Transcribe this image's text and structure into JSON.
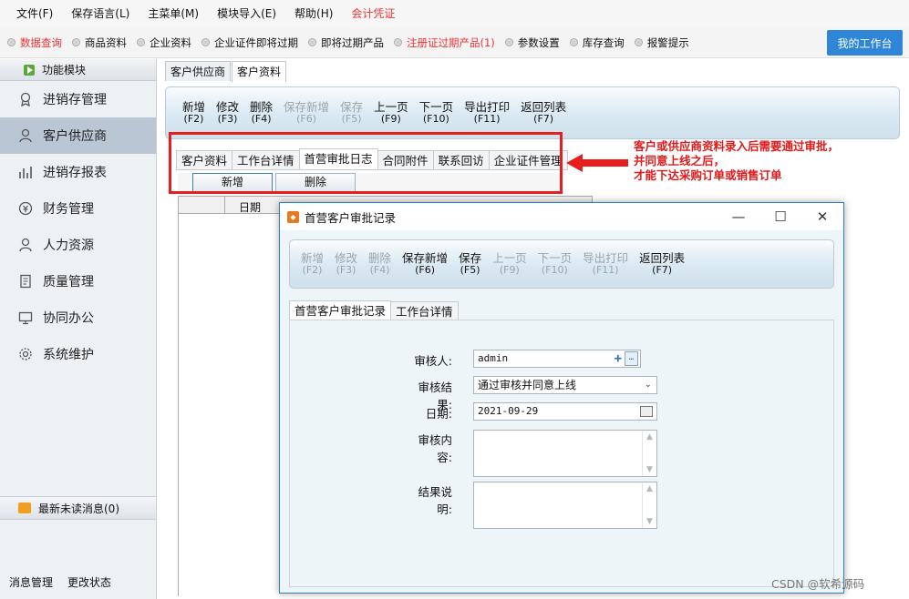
{
  "menu": [
    {
      "label": "文件(F)"
    },
    {
      "label": "保存语言(L)"
    },
    {
      "label": "主菜单(M)"
    },
    {
      "label": "模块导入(E)"
    },
    {
      "label": "帮助(H)"
    },
    {
      "label": "会计凭证"
    }
  ],
  "colors": {
    "accent_red": "#e33333",
    "workbench_blue": "#2f86d6",
    "active_nav": "#bac6d4",
    "annotation_red": "#e01a1a"
  },
  "quick": [
    {
      "label": "数据查询",
      "highlight": true
    },
    {
      "label": "商品资料"
    },
    {
      "label": "企业资料"
    },
    {
      "label": "企业证件即将过期"
    },
    {
      "label": "即将过期产品"
    },
    {
      "label": "注册证过期产品(1)",
      "highlight": true
    },
    {
      "label": "参数设置"
    },
    {
      "label": "库存查询"
    },
    {
      "label": "报警提示"
    }
  ],
  "workbench_label": "我的工作台",
  "sidebar": {
    "header": "功能模块",
    "items": [
      {
        "label": "进销存管理",
        "icon": "badge-icon"
      },
      {
        "label": "客户供应商",
        "icon": "person-icon",
        "active": true
      },
      {
        "label": "进销存报表",
        "icon": "bar-chart-icon"
      },
      {
        "label": "财务管理",
        "icon": "money-icon"
      },
      {
        "label": "人力资源",
        "icon": "person-icon"
      },
      {
        "label": "质量管理",
        "icon": "document-icon"
      },
      {
        "label": "协同办公",
        "icon": "monitor-icon"
      },
      {
        "label": "系统维护",
        "icon": "gear-icon"
      }
    ],
    "messages": "最新未读消息(0)",
    "footer": [
      "消息管理",
      "更改状态"
    ]
  },
  "page_tabs": [
    "客户供应商",
    "客户资料"
  ],
  "toolbar": [
    {
      "label": "新增",
      "key": "(F2)"
    },
    {
      "label": "修改",
      "key": "(F3)"
    },
    {
      "label": "删除",
      "key": "(F4)"
    },
    {
      "label": "保存新增",
      "key": "(F6)",
      "disabled": true
    },
    {
      "label": "保存",
      "key": "(F5)",
      "disabled": true
    },
    {
      "label": "上一页",
      "key": "(F9)"
    },
    {
      "label": "下一页",
      "key": "(F10)"
    },
    {
      "label": "导出打印",
      "key": "(F11)"
    },
    {
      "label": "返回列表",
      "key": "(F7)"
    }
  ],
  "inner_tabs": [
    "客户资料",
    "工作台详情",
    "首营审批日志",
    "合同附件",
    "联系回访",
    "企业证件管理"
  ],
  "inner_buttons": {
    "add": "新增",
    "delete": "删除"
  },
  "grid_header": {
    "date": "日期"
  },
  "annotation": [
    "客户或供应商资料录入后需要通过审批，",
    "并同意上线之后，",
    "才能下达采购订单或销售订单"
  ],
  "dialog": {
    "title": "首营客户审批记录",
    "toolbar": [
      {
        "label": "新增",
        "key": "(F2)",
        "disabled": true
      },
      {
        "label": "修改",
        "key": "(F3)",
        "disabled": true
      },
      {
        "label": "删除",
        "key": "(F4)",
        "disabled": true
      },
      {
        "label": "保存新增",
        "key": "(F6)"
      },
      {
        "label": "保存",
        "key": "(F5)"
      },
      {
        "label": "上一页",
        "key": "(F9)",
        "disabled": true
      },
      {
        "label": "下一页",
        "key": "(F10)",
        "disabled": true
      },
      {
        "label": "导出打印",
        "key": "(F11)",
        "disabled": true
      },
      {
        "label": "返回列表",
        "key": "(F7)"
      }
    ],
    "tabs": [
      "首营客户审批记录",
      "工作台详情"
    ],
    "form": {
      "reviewer_label": "审核人:",
      "reviewer_value": "admin",
      "result_label": "审核结果:",
      "result_value": "通过审核并同意上线",
      "date_label": "日期:",
      "date_value": "2021-09-29",
      "content_label": "审核内容:",
      "note_label": "结果说明:"
    }
  },
  "watermark": "CSDN @软希源码"
}
